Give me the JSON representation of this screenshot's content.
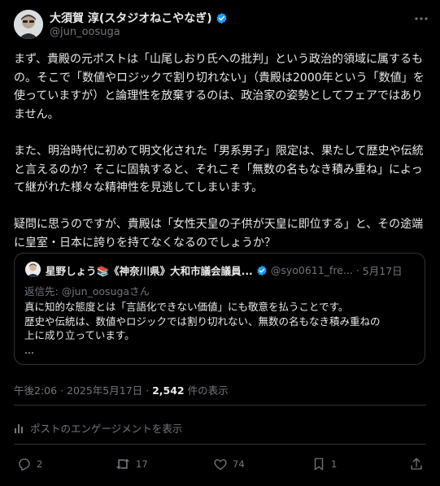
{
  "author": {
    "display_name": "大須賀 淳(スタジオねこやなぎ)",
    "handle": "@jun_oosuga"
  },
  "tweet": {
    "paragraphs": [
      "まず、貴殿の元ポストは「山尾しおり氏への批判」という政治的領域に属するもの。そこで「数値やロジックで割り切れない」（貴殿は2000年という「数値」を使っていますが）と論理性を放棄するのは、政治家の姿勢としてフェアではありません。",
      "また、明治時代に初めて明文化された「男系男子」限定は、果たして歴史や伝統と言えるのか？そこに固執すると、それこそ「無数の名もなき積み重ね」によって継がれた様々な精神性を見逃してしまいます。",
      "疑問に思うのですが、貴殿は「女性天皇の子供が天皇に即位する」と、その途端に皇室・日本に誇りを持てなくなるのでしょうか？"
    ]
  },
  "quote": {
    "display_name": "星野しょう📚《神奈川県》大和市議会議員...",
    "handle": "@syo0611_fre...",
    "separator": "·",
    "date": "5月17日",
    "reply_prefix": "返信先: ",
    "reply_handle": "@jun_oosugaさん",
    "text_lines": [
      "真に知的な態度とは「言語化できない価値」にも敬意を払うことです。",
      "歴史や伝統は、数値やロジックでは割り切れない、無数の名もなき積み重ねの",
      "上に成り立っています。",
      "..."
    ]
  },
  "meta": {
    "time": "午後2:06 · 2025年5月17日 · ",
    "views": "2,542",
    "views_label": " 件の表示"
  },
  "engagements_label": "ポストのエンゲージメントを表示",
  "actions": {
    "replies": "2",
    "reposts": "17",
    "likes": "74",
    "bookmarks": "1"
  },
  "colors": {
    "background": "#000000",
    "text": "#e7e9ea",
    "secondary": "#71767b",
    "border": "#2f3336",
    "verified": "#1d9bf0"
  },
  "icons": [
    "more-icon",
    "verified-icon",
    "reply-icon",
    "repost-icon",
    "like-icon",
    "bookmark-icon",
    "share-icon",
    "analytics-icon"
  ]
}
